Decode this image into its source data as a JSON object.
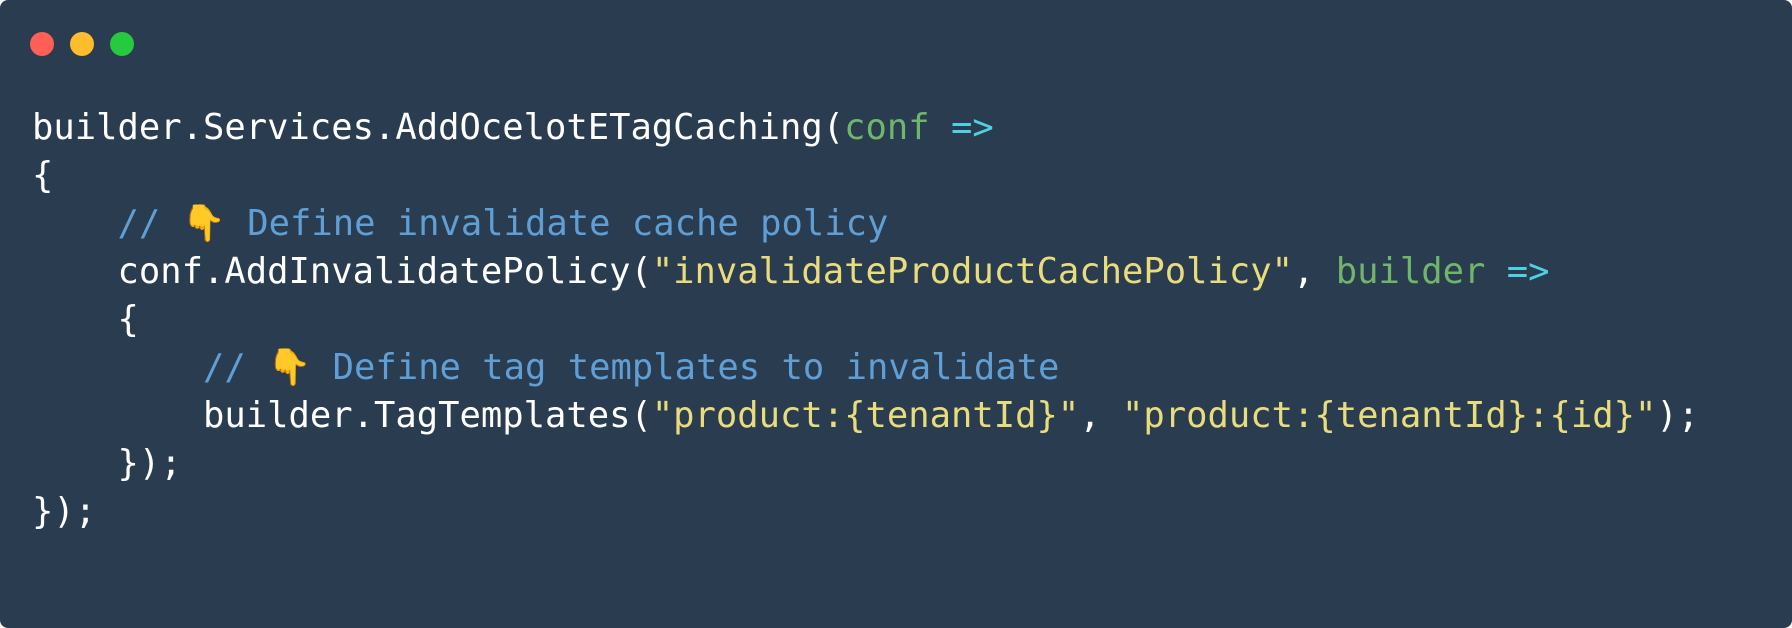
{
  "window": {
    "controls": [
      "close",
      "minimize",
      "maximize"
    ],
    "colors": {
      "background": "#2a3c4f",
      "close": "#ff5f56",
      "minimize": "#ffbd2e",
      "maximize": "#27c93f"
    }
  },
  "code": {
    "language": "csharp",
    "token_colors": {
      "plain": "#ffffff",
      "param": "#6fb56a",
      "arrow": "#4fd0e3",
      "comment": "#5f9fd6",
      "string": "#e9dc7d"
    },
    "lines": [
      [
        {
          "t": "plain",
          "v": "builder.Services.AddOcelotETagCaching("
        },
        {
          "t": "param",
          "v": "conf"
        },
        {
          "t": "plain",
          "v": " "
        },
        {
          "t": "arrow",
          "v": "=>"
        }
      ],
      [
        {
          "t": "plain",
          "v": "{"
        }
      ],
      [
        {
          "t": "plain",
          "v": "    "
        },
        {
          "t": "comment",
          "v": "// "
        },
        {
          "t": "emoji",
          "v": "👇"
        },
        {
          "t": "comment",
          "v": " Define invalidate cache policy"
        }
      ],
      [
        {
          "t": "plain",
          "v": "    conf.AddInvalidatePolicy("
        },
        {
          "t": "string",
          "v": "\"invalidateProductCachePolicy\""
        },
        {
          "t": "plain",
          "v": ", "
        },
        {
          "t": "param",
          "v": "builder"
        },
        {
          "t": "plain",
          "v": " "
        },
        {
          "t": "arrow",
          "v": "=>"
        }
      ],
      [
        {
          "t": "plain",
          "v": "    {"
        }
      ],
      [
        {
          "t": "plain",
          "v": "        "
        },
        {
          "t": "comment",
          "v": "// "
        },
        {
          "t": "emoji",
          "v": "👇"
        },
        {
          "t": "comment",
          "v": " Define tag templates to invalidate"
        }
      ],
      [
        {
          "t": "plain",
          "v": "        builder.TagTemplates("
        },
        {
          "t": "string",
          "v": "\"product:{tenantId}\""
        },
        {
          "t": "plain",
          "v": ", "
        },
        {
          "t": "string",
          "v": "\"product:{tenantId}:{id}\""
        },
        {
          "t": "plain",
          "v": ");"
        }
      ],
      [
        {
          "t": "plain",
          "v": "    });"
        }
      ],
      [
        {
          "t": "plain",
          "v": "});"
        }
      ]
    ]
  }
}
